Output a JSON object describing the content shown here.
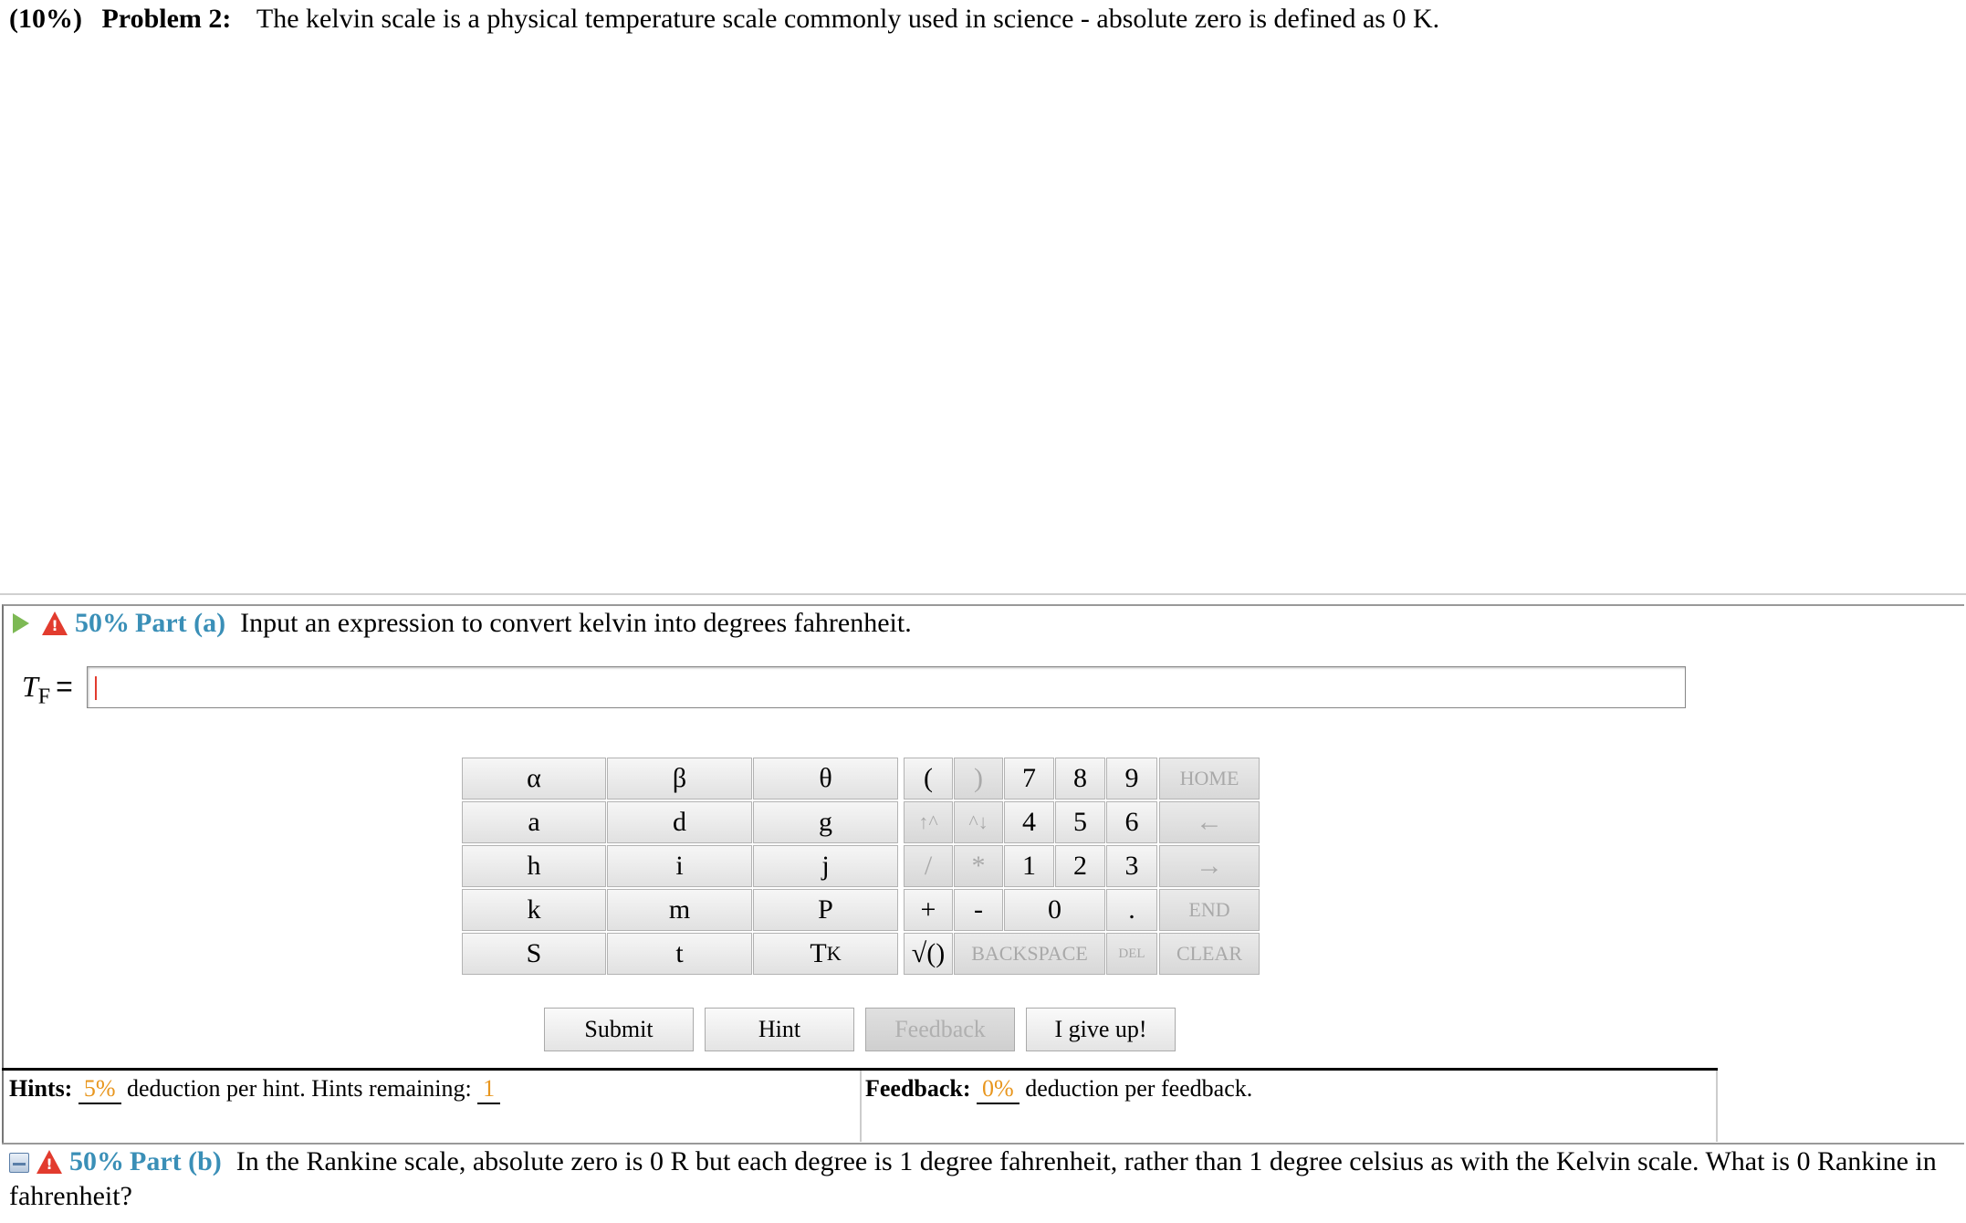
{
  "problem": {
    "weight": "(10%)",
    "label": "Problem 2:",
    "text": "The kelvin scale is a physical temperature scale commonly used in science - absolute zero is defined as 0 K."
  },
  "part_a": {
    "weight": "50%",
    "label": "Part (a)",
    "text": "Input an expression to convert kelvin into degrees fahrenheit.",
    "var_symbol": "T",
    "var_subscript": "F",
    "equals": "="
  },
  "keypad": {
    "vars": [
      [
        "α",
        "β",
        "θ"
      ],
      [
        "a",
        "d",
        "g"
      ],
      [
        "h",
        "i",
        "j"
      ],
      [
        "k",
        "m",
        "P"
      ],
      [
        "S",
        "t",
        "T"
      ]
    ],
    "tk_subscript": "K",
    "ops": {
      "open_paren": "(",
      "close_paren": ")",
      "up_caret": "↑^",
      "down_caret": "^↓",
      "divide": "/",
      "multiply": "*",
      "plus": "+",
      "minus": "-",
      "sqrt": "√()",
      "backspace": "BACKSPACE",
      "del": "DEL",
      "clear": "CLEAR",
      "home": "HOME",
      "left": "←",
      "right": "→",
      "end": "END"
    },
    "digits": {
      "d7": "7",
      "d8": "8",
      "d9": "9",
      "d4": "4",
      "d5": "5",
      "d6": "6",
      "d1": "1",
      "d2": "2",
      "d3": "3",
      "d0": "0",
      "dot": "."
    }
  },
  "buttons": {
    "submit": "Submit",
    "hint": "Hint",
    "feedback": "Feedback",
    "give_up": "I give up!"
  },
  "hints": {
    "label": "Hints:",
    "deduction": "5%",
    "text": "deduction per hint. Hints remaining:",
    "remaining": "1"
  },
  "feedback": {
    "label": "Feedback:",
    "deduction": "0%",
    "text": "deduction per feedback."
  },
  "part_b": {
    "weight": "50%",
    "label": "Part (b)",
    "text": "In the Rankine scale, absolute zero is 0 R but each degree is 1 degree fahrenheit, rather than 1 degree celsius as with the Kelvin scale. What is 0 Rankine in fahrenheit?"
  },
  "colors": {
    "part_accent": "#3a8fb7",
    "deduction": "#e8961e",
    "warning": "#e23b2e",
    "expand_arrow": "#7db954"
  }
}
